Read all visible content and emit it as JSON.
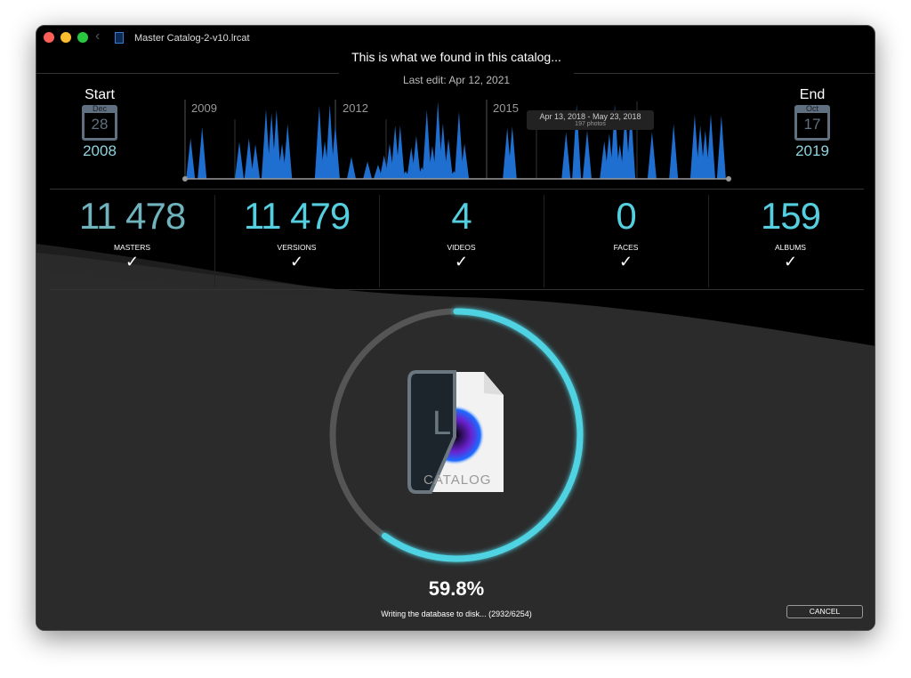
{
  "window": {
    "title": "Master Catalog-2-v10.lrcat"
  },
  "header": {
    "title": "This is what we found in this catalog...",
    "last_edit": "Last edit: Apr 12, 2021"
  },
  "start": {
    "label": "Start",
    "month": "Dec",
    "day": "28",
    "year": "2008"
  },
  "end": {
    "label": "End",
    "month": "Oct",
    "day": "17",
    "year": "2019"
  },
  "timeline": {
    "year_labels": [
      "2009",
      "2012",
      "2015"
    ],
    "tooltip": {
      "range": "Apr 13, 2018 - May 23, 2018",
      "count": "197 photos"
    },
    "bar_color": "#1f6fd1",
    "spikes": [
      [
        2009.11,
        0.52
      ],
      [
        2009.34,
        0.66
      ],
      [
        2010.08,
        0.47
      ],
      [
        2010.27,
        0.52
      ],
      [
        2010.4,
        0.44
      ],
      [
        2010.61,
        0.89
      ],
      [
        2010.72,
        0.84
      ],
      [
        2010.82,
        0.88
      ],
      [
        2010.93,
        0.45
      ],
      [
        2011.04,
        0.7
      ],
      [
        2011.67,
        0.93
      ],
      [
        2011.78,
        0.48
      ],
      [
        2011.88,
        0.95
      ],
      [
        2011.99,
        0.7
      ],
      [
        2012.31,
        0.28
      ],
      [
        2012.63,
        0.22
      ],
      [
        2012.84,
        0.18
      ],
      [
        2012.96,
        0.3
      ],
      [
        2013.07,
        0.45
      ],
      [
        2013.18,
        0.68
      ],
      [
        2013.28,
        0.68
      ],
      [
        2013.39,
        0.1
      ],
      [
        2013.5,
        0.4
      ],
      [
        2013.6,
        0.55
      ],
      [
        2013.71,
        0.15
      ],
      [
        2013.81,
        0.88
      ],
      [
        2013.92,
        0.42
      ],
      [
        2014.03,
        0.99
      ],
      [
        2014.13,
        0.71
      ],
      [
        2014.24,
        0.51
      ],
      [
        2014.35,
        0.1
      ],
      [
        2014.45,
        0.86
      ],
      [
        2014.56,
        0.45
      ],
      [
        2015.41,
        0.65
      ],
      [
        2015.51,
        0.67
      ],
      [
        2016.58,
        0.6
      ],
      [
        2016.79,
        0.95
      ],
      [
        2017.0,
        0.62
      ],
      [
        2017.34,
        0.48
      ],
      [
        2017.44,
        0.58
      ],
      [
        2017.55,
        0.95
      ],
      [
        2017.65,
        0.44
      ],
      [
        2017.76,
        0.88
      ],
      [
        2017.87,
        0.89
      ],
      [
        2018.29,
        0.6
      ],
      [
        2018.72,
        0.7
      ],
      [
        2019.14,
        0.82
      ],
      [
        2019.25,
        0.68
      ],
      [
        2019.35,
        0.62
      ],
      [
        2019.46,
        0.83
      ],
      [
        2019.67,
        0.81
      ]
    ]
  },
  "stats": [
    {
      "value": "11 478",
      "label": "MASTERS",
      "color": "#6fb3bd"
    },
    {
      "value": "11 479",
      "label": "VERSIONS",
      "color": "#55cfe0"
    },
    {
      "value": "4",
      "label": "VIDEOS",
      "color": "#55cfe0"
    },
    {
      "value": "0",
      "label": "FACES",
      "color": "#55cfe0"
    },
    {
      "value": "159",
      "label": "ALBUMS",
      "color": "#55cfe0"
    }
  ],
  "check_glyph": "✓",
  "progress": {
    "percent": 59.8,
    "percent_label": "59.8%",
    "status": "Writing the database to disk... (2932/6254)",
    "color": "#4fd3e3",
    "track_color": "#555555"
  },
  "icon": {
    "letter": "L",
    "caption": "CATALOG"
  },
  "cancel_label": "CANCEL"
}
